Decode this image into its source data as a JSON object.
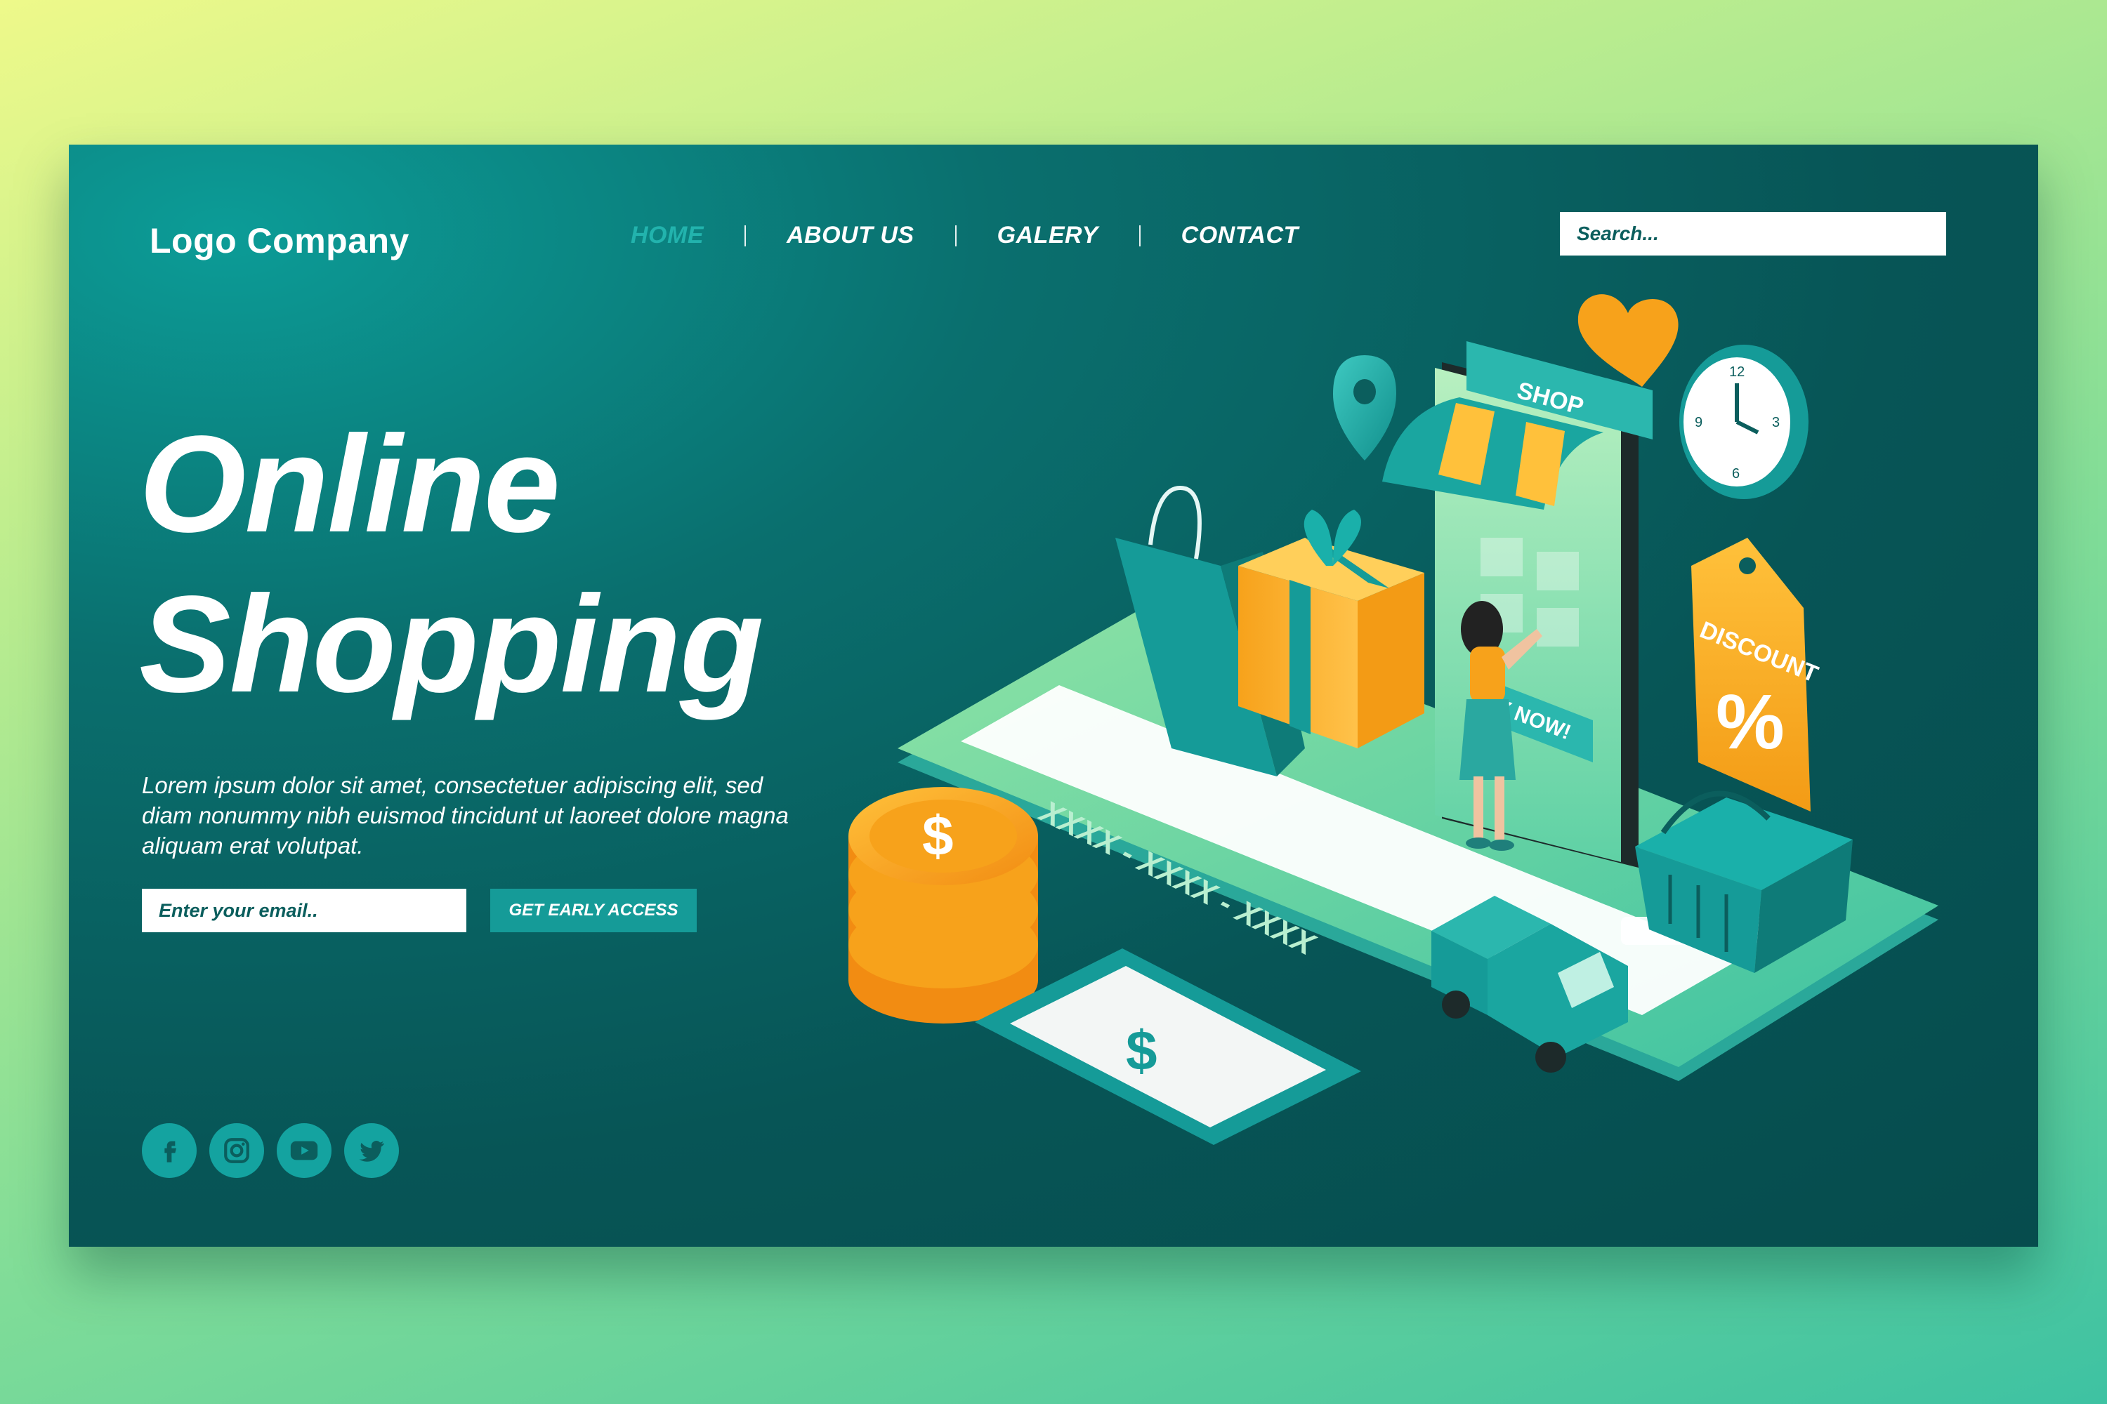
{
  "header": {
    "logo": "Logo Company",
    "nav": [
      {
        "label": "HOME",
        "active": true
      },
      {
        "label": "ABOUT US",
        "active": false
      },
      {
        "label": "GALERY",
        "active": false
      },
      {
        "label": "CONTACT",
        "active": false
      }
    ],
    "search": {
      "placeholder": "Search..."
    }
  },
  "hero": {
    "title_line1": "Online",
    "title_line2": "Shopping",
    "description": "Lorem ipsum dolor sit amet, consectetuer adipiscing elit, sed diam nonummy nibh euismod tincidunt ut laoreet dolore magna aliquam erat volutpat.",
    "email_placeholder": "Enter your email..",
    "cta_label": "GET EARLY ACCESS"
  },
  "social": [
    {
      "name": "facebook-icon"
    },
    {
      "name": "instagram-icon"
    },
    {
      "name": "youtube-icon"
    },
    {
      "name": "twitter-icon"
    }
  ],
  "illustration": {
    "shop_sign": "SHOP",
    "buy_button": "Y NOW!",
    "discount_label": "DISCOUNT",
    "discount_symbol": "%",
    "card_number": "XXXX - XXXX - XXXX",
    "currency_symbol": "$",
    "clock_numbers": [
      "12",
      "3",
      "6",
      "9"
    ]
  },
  "colors": {
    "background_top": "#eef98a",
    "background_bottom": "#3ec2a2",
    "panel": "#075556",
    "accent_teal": "#159b98",
    "nav_active": "#22b3ad",
    "accent_orange": "#f7a21b"
  }
}
